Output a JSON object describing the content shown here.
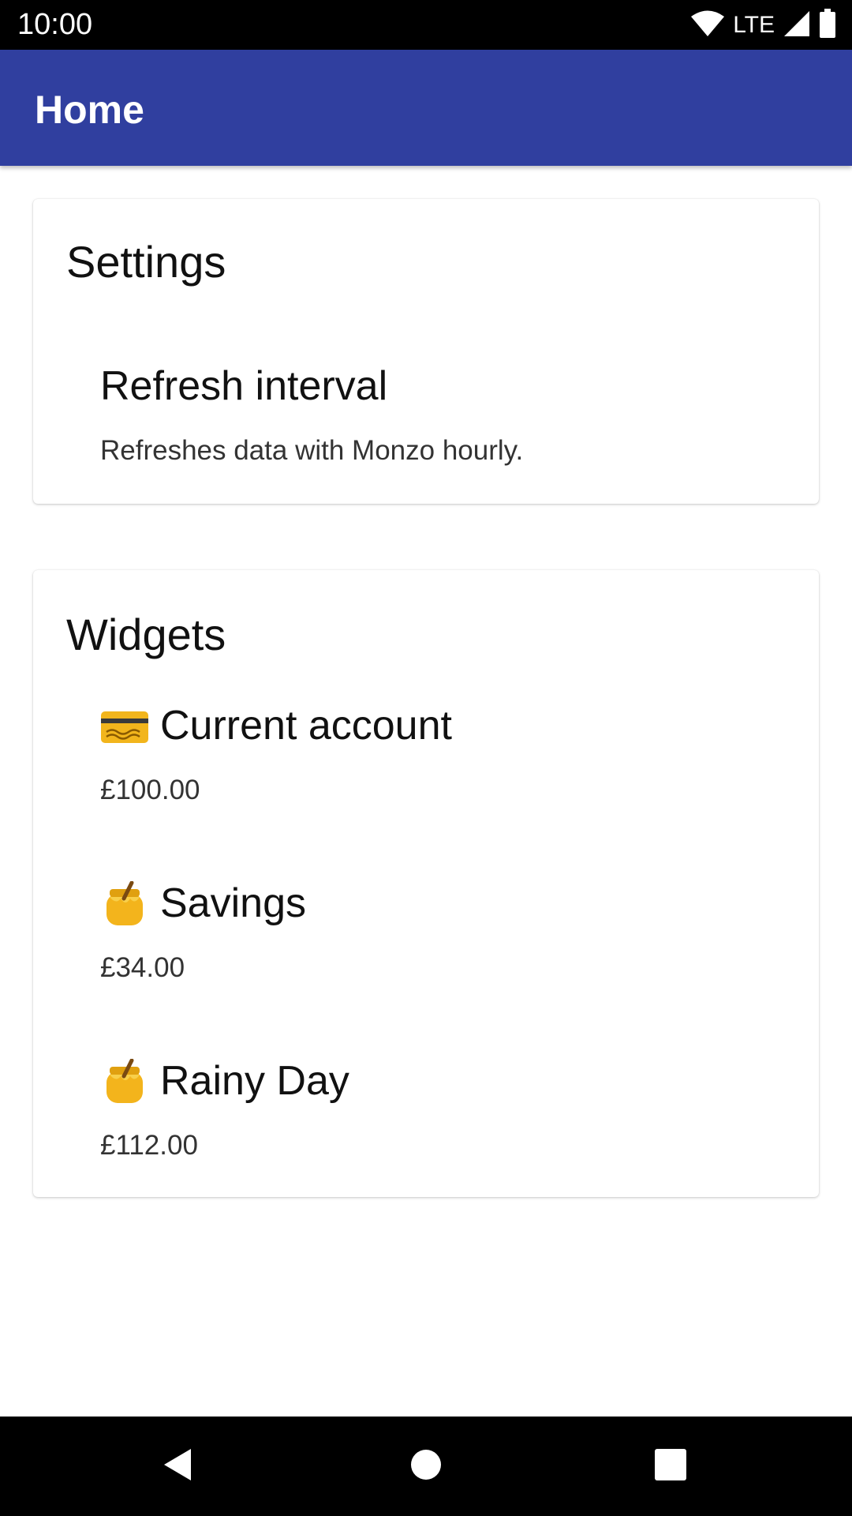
{
  "status_bar": {
    "time": "10:00",
    "network": "LTE",
    "icons": [
      "wifi-icon",
      "cell-signal-icon",
      "battery-icon"
    ]
  },
  "app_bar": {
    "title": "Home",
    "color": "#303f9f"
  },
  "settings_card": {
    "title": "Settings",
    "items": [
      {
        "title": "Refresh interval",
        "subtitle": "Refreshes data with Monzo hourly."
      }
    ]
  },
  "widgets_card": {
    "title": "Widgets",
    "items": [
      {
        "icon": "credit-card-emoji-icon",
        "title": "Current account",
        "amount": "£100.00"
      },
      {
        "icon": "honey-pot-emoji-icon",
        "title": "Savings",
        "amount": "£34.00"
      },
      {
        "icon": "honey-pot-emoji-icon",
        "title": "Rainy Day",
        "amount": "£112.00"
      }
    ]
  },
  "nav_bar": {
    "buttons": [
      "back-icon",
      "home-icon",
      "recents-icon"
    ]
  }
}
